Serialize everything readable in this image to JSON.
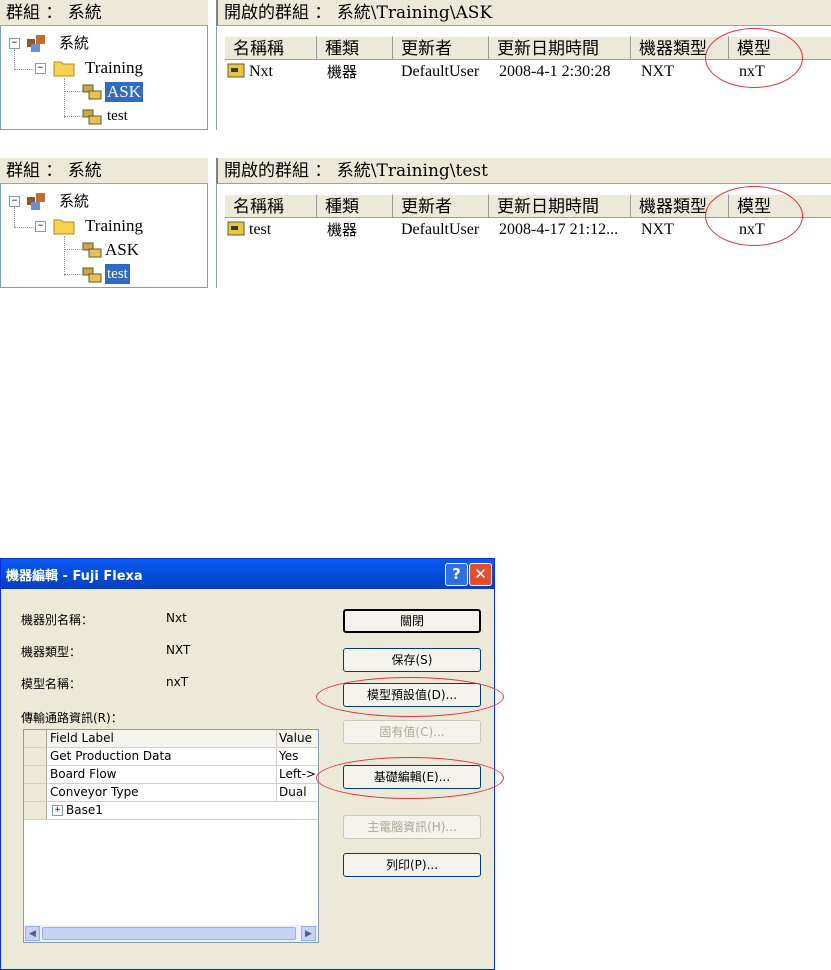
{
  "panel1": {
    "group_header": "群組 ： 系統",
    "path_header": "開啟的群組 ： 系統\\Training\\ASK",
    "tree": {
      "root": "系統",
      "folder": "Training",
      "items": [
        "ASK",
        "test"
      ],
      "selected_index": 0
    },
    "columns": [
      "名稱稱",
      "種類",
      "更新者",
      "更新日期時間",
      "機器類型",
      "模型"
    ],
    "row": {
      "name": "Nxt",
      "kind": "機器",
      "updater": "DefaultUser",
      "datetime": "2008-4-1 2:30:28",
      "machine_type": "NXT",
      "model": "nxT"
    }
  },
  "panel2": {
    "group_header": "群組 ： 系統",
    "path_header": "開啟的群組 ： 系統\\Training\\test",
    "tree": {
      "root": "系統",
      "folder": "Training",
      "items": [
        "ASK",
        "test"
      ],
      "selected_index": 1
    },
    "columns": [
      "名稱稱",
      "種類",
      "更新者",
      "更新日期時間",
      "機器類型",
      "模型"
    ],
    "row": {
      "name": "test",
      "kind": "機器",
      "updater": "DefaultUser",
      "datetime": "2008-4-17 21:12...",
      "machine_type": "NXT",
      "model": "nxT"
    }
  },
  "dialog": {
    "title": "機器編輯 - Fuji Flexa",
    "help_glyph": "?",
    "close_glyph": "✕",
    "fields": [
      {
        "label": "機器別名稱：",
        "value": "Nxt"
      },
      {
        "label": "機器類型：",
        "value": "NXT"
      },
      {
        "label": "模型名稱：",
        "value": "nxT"
      }
    ],
    "transport_label": "傳輸通路資訊(R)：",
    "grid": {
      "headers": [
        "Field Label",
        "Value"
      ],
      "rows": [
        {
          "label": "Get Production Data",
          "value": "Yes"
        },
        {
          "label": "Board Flow",
          "value": "Left->"
        },
        {
          "label": "Conveyor Type",
          "value": "Dual"
        },
        {
          "label": "Base1",
          "value": ""
        }
      ]
    },
    "buttons": {
      "close": "關閉",
      "save": "保存(S)",
      "model_defaults": "模型預設值(D)...",
      "fixed_values": "固有值(C)...",
      "base_edit": "基礎編輯(E)...",
      "host_info": "主電腦資訊(H)...",
      "print": "列印(P)..."
    },
    "accent_color": "#0a5bf0",
    "highlight_color": "#e2323a"
  }
}
